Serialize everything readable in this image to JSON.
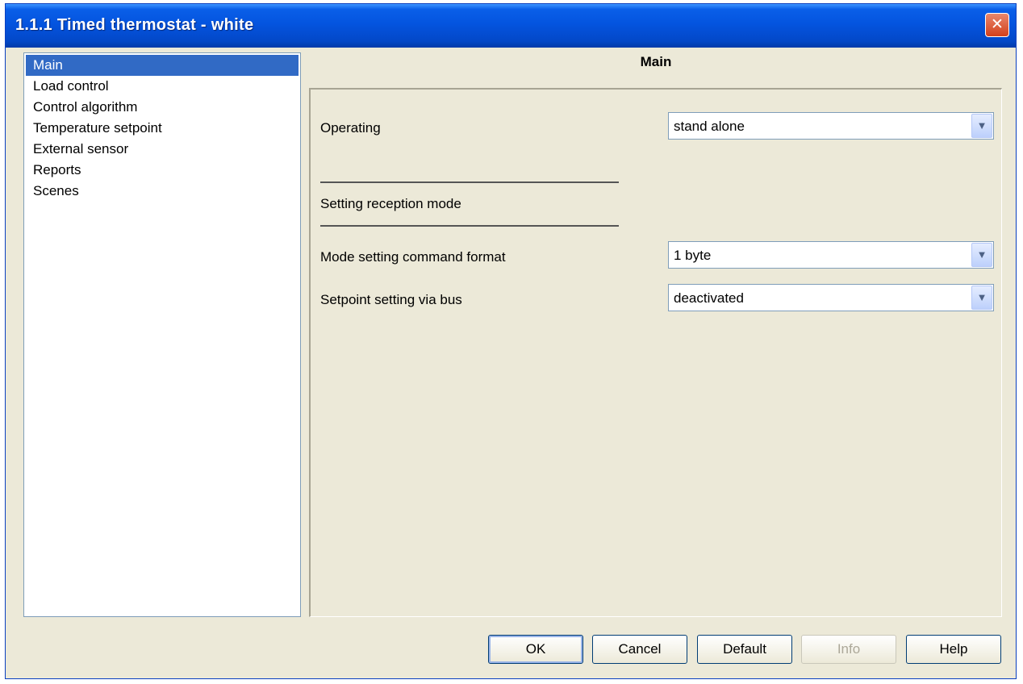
{
  "window": {
    "title": "1.1.1 Timed thermostat - white",
    "close_glyph": "✕"
  },
  "nav": {
    "items": [
      {
        "label": "Main",
        "selected": true
      },
      {
        "label": "Load control"
      },
      {
        "label": "Control algorithm"
      },
      {
        "label": "Temperature setpoint"
      },
      {
        "label": "External sensor"
      },
      {
        "label": "Reports"
      },
      {
        "label": "Scenes"
      }
    ]
  },
  "panel": {
    "title": "Main",
    "operating": {
      "label": "Operating",
      "value": "stand alone"
    },
    "section_heading": "Setting reception mode",
    "mode_format": {
      "label": "Mode setting command format",
      "value": "1 byte"
    },
    "setpoint_bus": {
      "label": "Setpoint setting via bus",
      "value": "deactivated"
    },
    "dropdown_glyph": "▼"
  },
  "buttons": {
    "ok": "OK",
    "cancel": "Cancel",
    "default": "Default",
    "info": "Info",
    "help": "Help"
  },
  "colors": {
    "selection": "#316ac5",
    "dialog_bg": "#ece9d8",
    "titlebar": "#0454df",
    "close": "#d3401b"
  },
  "icons": {
    "close": "close-icon",
    "dropdown": "chevron-down-icon"
  }
}
